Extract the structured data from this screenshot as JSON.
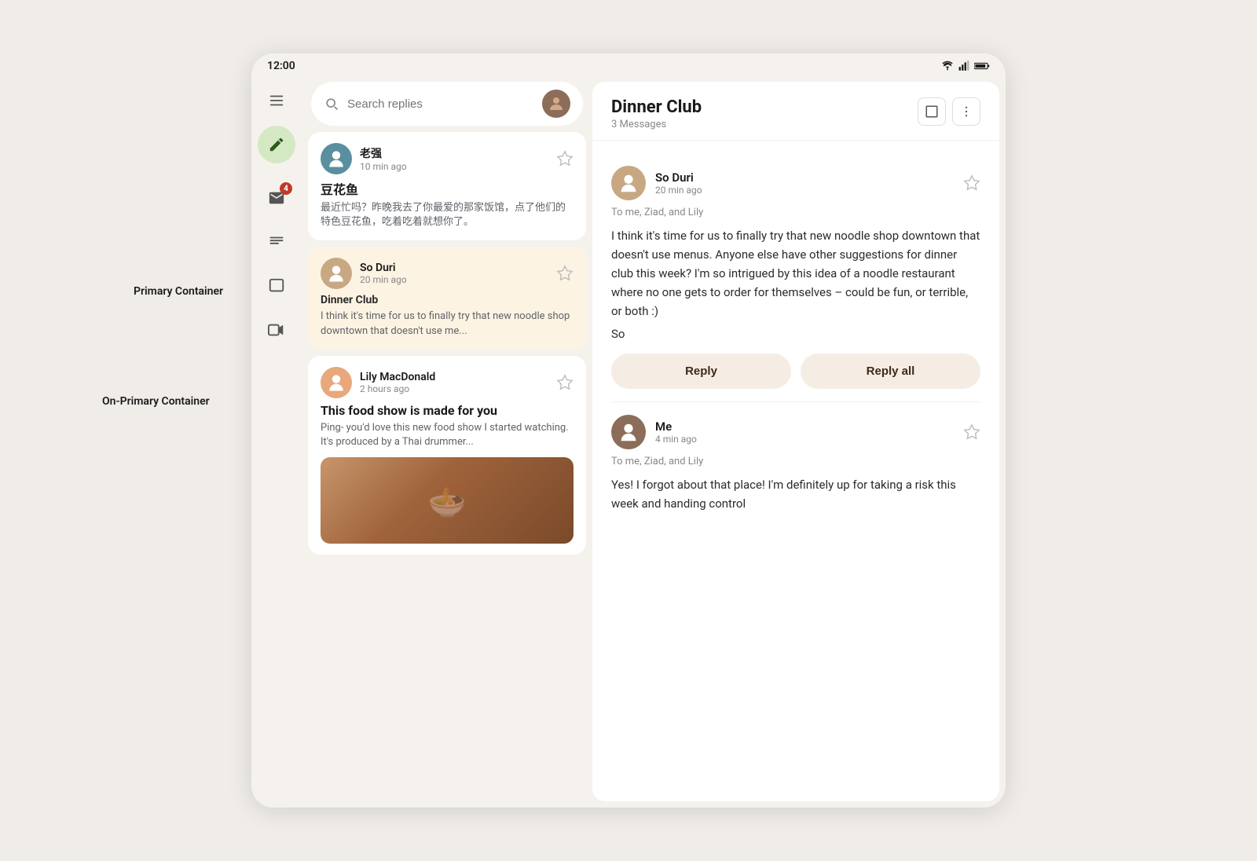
{
  "statusBar": {
    "time": "12:00",
    "icons": [
      "wifi",
      "signal",
      "battery"
    ]
  },
  "sidebar": {
    "icons": [
      {
        "name": "menu",
        "symbol": "≡"
      },
      {
        "name": "compose",
        "symbol": "✏",
        "bg": "#d5e8c4"
      },
      {
        "name": "mail-badge",
        "symbol": "📁",
        "badge": "4"
      },
      {
        "name": "notes",
        "symbol": "≣"
      },
      {
        "name": "chat",
        "symbol": "□"
      },
      {
        "name": "video",
        "symbol": "▷"
      }
    ]
  },
  "searchBar": {
    "placeholder": "Search replies",
    "avatarColor": "#8b6d5a"
  },
  "emailList": {
    "items": [
      {
        "id": "email-1",
        "sender": "老强",
        "time": "10 min ago",
        "subject": "豆花鱼",
        "preview": "最近忙吗？昨晚我去了你最爱的那家饭馆，点了他们的特色豆花鱼，吃着吃着就想你了。",
        "avatarColor": "#5a8fa0",
        "selected": false,
        "starred": false
      },
      {
        "id": "email-2",
        "sender": "So Duri",
        "time": "20 min ago",
        "subject": "Dinner Club",
        "preview": "I think it's time for us to finally try that new noodle shop downtown that doesn't use me...",
        "avatarColor": "#c8b89a",
        "selected": true,
        "starred": false
      },
      {
        "id": "email-3",
        "sender": "Lily MacDonald",
        "time": "2 hours ago",
        "subject": "This food show is made for you",
        "preview": "Ping- you'd love this new food show I started watching. It's produced by a Thai drummer...",
        "avatarColor": "#e8a87c",
        "selected": false,
        "starred": false
      }
    ]
  },
  "emailDetail": {
    "title": "Dinner Club",
    "subtitle": "3 Messages",
    "messages": [
      {
        "id": "msg-1",
        "sender": "So Duri",
        "time": "20 min ago",
        "to": "To me, Ziad, and Lily",
        "avatarColor": "#c8b89a",
        "body": "I think it's time for us to finally try that new noodle shop downtown that doesn't use menus. Anyone else have other suggestions for dinner club this week? I'm so intrigued by this idea of a noodle restaurant where no one gets to order for themselves – could be fun, or terrible, or both :)",
        "signature": "So",
        "showReplyActions": true,
        "starred": false
      },
      {
        "id": "msg-2",
        "sender": "Me",
        "time": "4 min ago",
        "to": "To me, Ziad, and Lily",
        "avatarColor": "#8b6d5a",
        "body": "Yes! I forgot about that place! I'm definitely up for taking a risk this week and handing control",
        "showReplyActions": false,
        "starred": false
      }
    ],
    "replyButton": "Reply",
    "replyAllButton": "Reply all"
  },
  "annotations": {
    "primaryContainer": "Primary Container",
    "onPrimaryContainer": "On-Primary Container"
  }
}
